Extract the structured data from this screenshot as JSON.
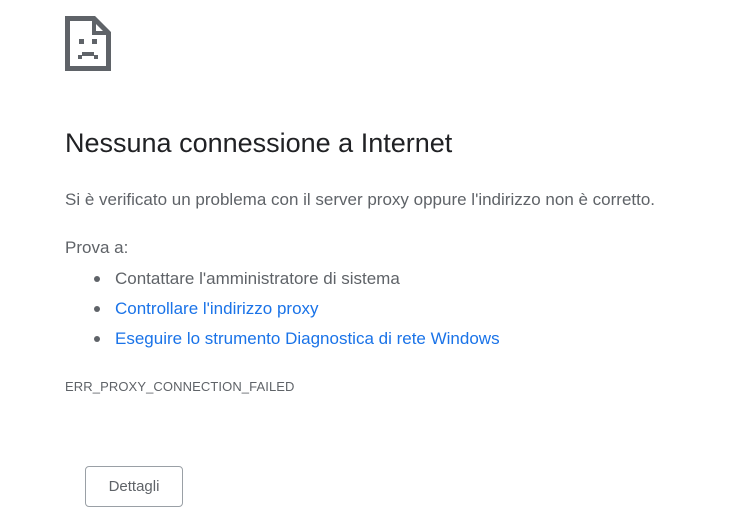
{
  "error_page": {
    "icon": "sad-document-icon",
    "title": "Nessuna connessione a Internet",
    "summary": "Si è verificato un problema con il server proxy oppure l'indirizzo non è corretto.",
    "try_label": "Prova a:",
    "suggestions": [
      {
        "text": "Contattare l'amministratore di sistema",
        "is_link": false
      },
      {
        "text": "Controllare l'indirizzo proxy",
        "is_link": true
      },
      {
        "text": "Eseguire lo strumento Diagnostica di rete Windows",
        "is_link": true
      }
    ],
    "error_code": "ERR_PROXY_CONNECTION_FAILED",
    "details_button_label": "Dettagli"
  },
  "colors": {
    "title_text": "#202124",
    "body_text": "#5f6368",
    "link": "#1a73e8",
    "icon": "#5f6368",
    "button_border": "#9aa0a6"
  }
}
